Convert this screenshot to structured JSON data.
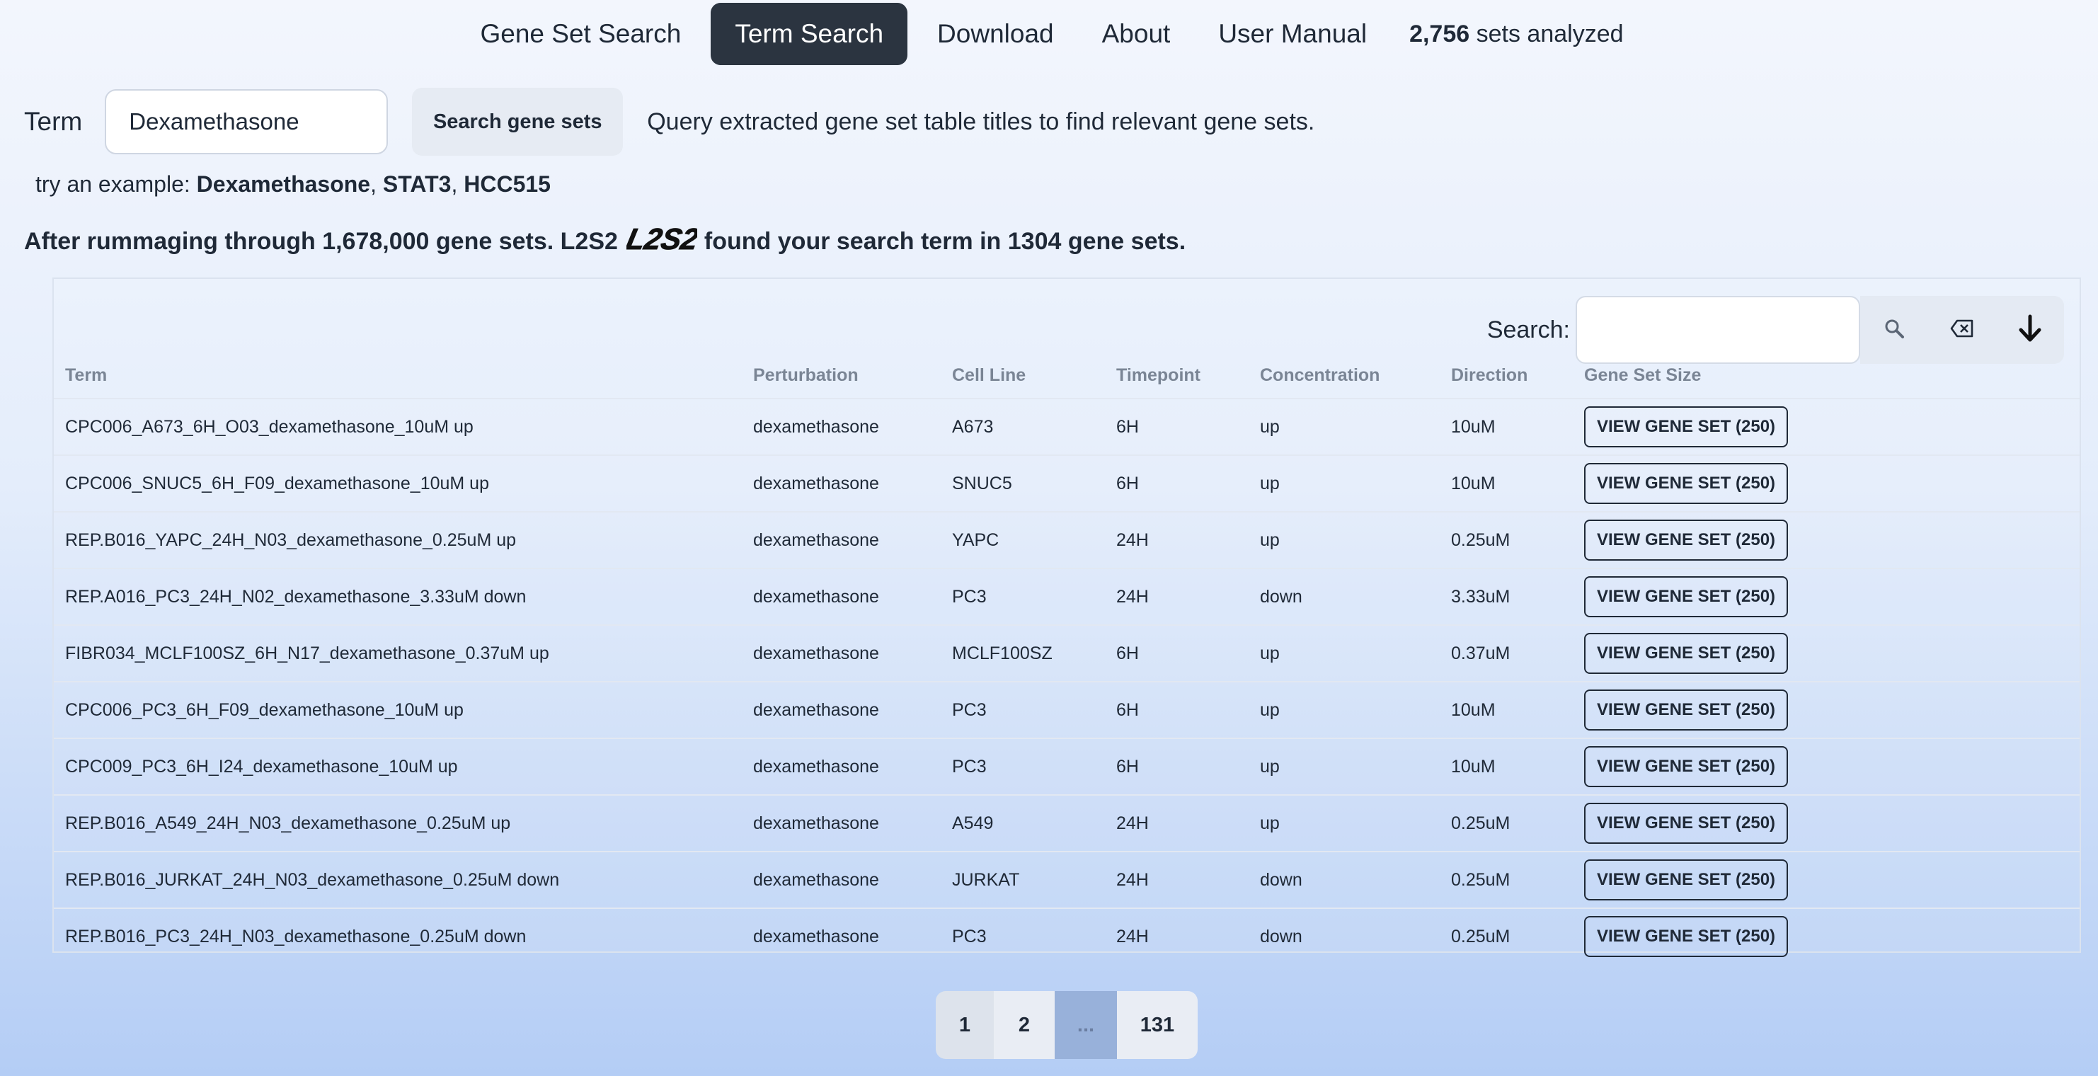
{
  "nav": {
    "items": [
      {
        "label": "Gene Set Search"
      },
      {
        "label": "Term Search"
      },
      {
        "label": "Download"
      },
      {
        "label": "About"
      },
      {
        "label": "User Manual"
      }
    ],
    "active": "Term Search",
    "stat_count": "2,756",
    "stat_text": " sets analyzed"
  },
  "search": {
    "label": "Term",
    "value": "Dexamethasone",
    "button_label": "Search gene sets",
    "hint": "Query extracted gene set table titles to find relevant gene sets."
  },
  "examples": {
    "prefix": "try an example: ",
    "items": [
      "Dexamethasone",
      "STAT3",
      "HCC515"
    ],
    "sep": ", "
  },
  "result": {
    "before": "After rummaging through 1,678,000 gene sets. L2S2",
    "logo_text": "L2S2",
    "after": "found your search term in 1304 gene sets."
  },
  "table": {
    "search_label": "Search:",
    "search_value": "",
    "icons": [
      "search-icon",
      "clear-icon",
      "download-icon"
    ],
    "headers": [
      "Term",
      "Perturbation",
      "Cell Line",
      "Timepoint",
      "Concentration",
      "Direction",
      "Gene Set Size"
    ],
    "rows": [
      {
        "term": "CPC006_A673_6H_O03_dexamethasone_10uM up",
        "pert": "dexamethasone",
        "cell": "A673",
        "time": "6H",
        "conc": "up",
        "dir": "10uM",
        "btn": "VIEW GENE SET (250)"
      },
      {
        "term": "CPC006_SNUC5_6H_F09_dexamethasone_10uM up",
        "pert": "dexamethasone",
        "cell": "SNUC5",
        "time": "6H",
        "conc": "up",
        "dir": "10uM",
        "btn": "VIEW GENE SET (250)"
      },
      {
        "term": "REP.B016_YAPC_24H_N03_dexamethasone_0.25uM up",
        "pert": "dexamethasone",
        "cell": "YAPC",
        "time": "24H",
        "conc": "up",
        "dir": "0.25uM",
        "btn": "VIEW GENE SET (250)"
      },
      {
        "term": "REP.A016_PC3_24H_N02_dexamethasone_3.33uM down",
        "pert": "dexamethasone",
        "cell": "PC3",
        "time": "24H",
        "conc": "down",
        "dir": "3.33uM",
        "btn": "VIEW GENE SET (250)"
      },
      {
        "term": "FIBR034_MCLF100SZ_6H_N17_dexamethasone_0.37uM up",
        "pert": "dexamethasone",
        "cell": "MCLF100SZ",
        "time": "6H",
        "conc": "up",
        "dir": "0.37uM",
        "btn": "VIEW GENE SET (250)"
      },
      {
        "term": "CPC006_PC3_6H_F09_dexamethasone_10uM up",
        "pert": "dexamethasone",
        "cell": "PC3",
        "time": "6H",
        "conc": "up",
        "dir": "10uM",
        "btn": "VIEW GENE SET (250)"
      },
      {
        "term": "CPC009_PC3_6H_I24_dexamethasone_10uM up",
        "pert": "dexamethasone",
        "cell": "PC3",
        "time": "6H",
        "conc": "up",
        "dir": "10uM",
        "btn": "VIEW GENE SET (250)"
      },
      {
        "term": "REP.B016_A549_24H_N03_dexamethasone_0.25uM up",
        "pert": "dexamethasone",
        "cell": "A549",
        "time": "24H",
        "conc": "up",
        "dir": "0.25uM",
        "btn": "VIEW GENE SET (250)"
      },
      {
        "term": "REP.B016_JURKAT_24H_N03_dexamethasone_0.25uM down",
        "pert": "dexamethasone",
        "cell": "JURKAT",
        "time": "24H",
        "conc": "down",
        "dir": "0.25uM",
        "btn": "VIEW GENE SET (250)"
      },
      {
        "term": "REP.B016_PC3_24H_N03_dexamethasone_0.25uM down",
        "pert": "dexamethasone",
        "cell": "PC3",
        "time": "24H",
        "conc": "down",
        "dir": "0.25uM",
        "btn": "VIEW GENE SET (250)"
      }
    ]
  },
  "pagination": {
    "pages": [
      "1",
      "2",
      "...",
      "131"
    ],
    "current": "1"
  },
  "colors": {
    "nav_active_bg": "#2b3440",
    "gradient_top": "#f3f6fd",
    "gradient_bottom": "#b4cdf5",
    "ellipsis_bg": "#98b1da"
  }
}
